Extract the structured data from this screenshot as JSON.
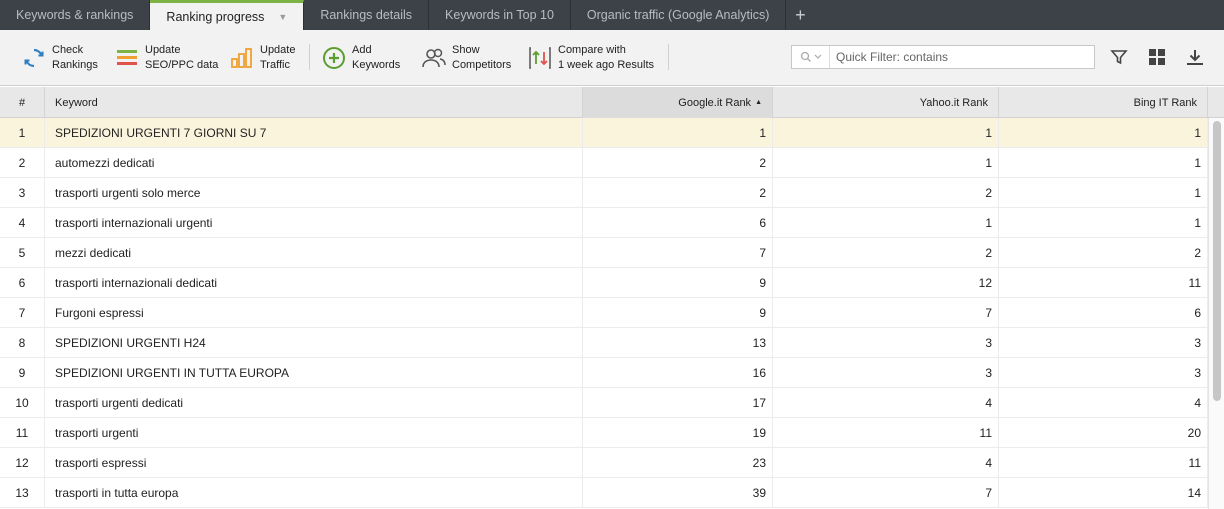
{
  "tabs": [
    {
      "label": "Keywords & rankings",
      "active": false
    },
    {
      "label": "Ranking progress",
      "active": true
    },
    {
      "label": "Rankings details",
      "active": false
    },
    {
      "label": "Keywords in Top 10",
      "active": false
    },
    {
      "label": "Organic traffic (Google Analytics)",
      "active": false
    }
  ],
  "tab_add_label": "+",
  "toolbar": {
    "check_rankings": "Check\nRankings",
    "update_seo": "Update\nSEO/PPC data",
    "update_traffic": "Update\nTraffic",
    "add_keywords": "Add\nKeywords",
    "show_competitors": "Show\nCompetitors",
    "compare": "Compare with\n1 week ago Results",
    "filter_placeholder": "Quick Filter: contains"
  },
  "columns": {
    "num": "#",
    "keyword": "Keyword",
    "google": "Google.it Rank",
    "yahoo": "Yahoo.it Rank",
    "bing": "Bing IT Rank"
  },
  "colors": {
    "accent": "#7cb342",
    "selected_row": "#fbf4dc"
  },
  "rows": [
    {
      "n": "1",
      "keyword": "SPEDIZIONI URGENTI 7 GIORNI SU 7",
      "google": "1",
      "yahoo": "1",
      "bing": "1"
    },
    {
      "n": "2",
      "keyword": "automezzi dedicati",
      "google": "2",
      "yahoo": "1",
      "bing": "1"
    },
    {
      "n": "3",
      "keyword": "trasporti urgenti solo merce",
      "google": "2",
      "yahoo": "2",
      "bing": "1"
    },
    {
      "n": "4",
      "keyword": "trasporti internazionali urgenti",
      "google": "6",
      "yahoo": "1",
      "bing": "1"
    },
    {
      "n": "5",
      "keyword": "mezzi dedicati",
      "google": "7",
      "yahoo": "2",
      "bing": "2"
    },
    {
      "n": "6",
      "keyword": "trasporti internazionali dedicati",
      "google": "9",
      "yahoo": "12",
      "bing": "11"
    },
    {
      "n": "7",
      "keyword": "Furgoni espressi",
      "google": "9",
      "yahoo": "7",
      "bing": "6"
    },
    {
      "n": "8",
      "keyword": "SPEDIZIONI URGENTI H24",
      "google": "13",
      "yahoo": "3",
      "bing": "3"
    },
    {
      "n": "9",
      "keyword": "SPEDIZIONI URGENTI IN TUTTA EUROPA",
      "google": "16",
      "yahoo": "3",
      "bing": "3"
    },
    {
      "n": "10",
      "keyword": "trasporti urgenti dedicati",
      "google": "17",
      "yahoo": "4",
      "bing": "4"
    },
    {
      "n": "11",
      "keyword": "trasporti urgenti",
      "google": "19",
      "yahoo": "11",
      "bing": "20"
    },
    {
      "n": "12",
      "keyword": "trasporti espressi",
      "google": "23",
      "yahoo": "4",
      "bing": "11"
    },
    {
      "n": "13",
      "keyword": "trasporti in tutta europa",
      "google": "39",
      "yahoo": "7",
      "bing": "14"
    }
  ]
}
